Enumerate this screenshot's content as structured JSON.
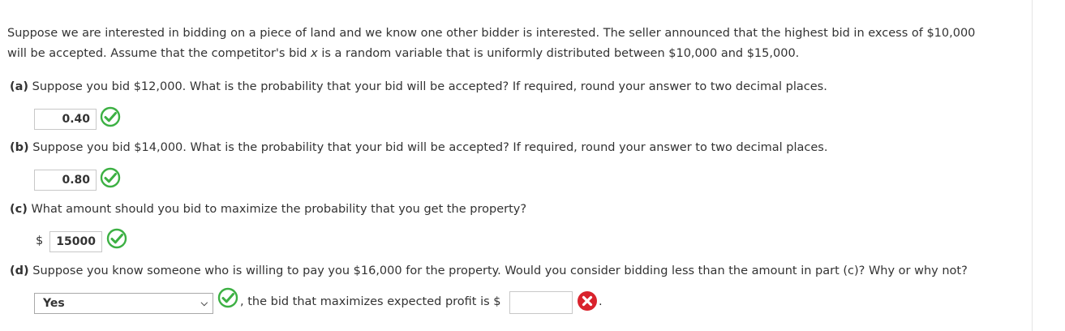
{
  "intro": {
    "line1": "Suppose we are interested in bidding on a piece of land and we know one other bidder is interested. The seller announced that the highest bid in excess of $10,000",
    "line2_a": "will be accepted. Assume that the competitor's bid ",
    "line2_var": "x",
    "line2_b": " is a random variable that is uniformly distributed between $10,000 and $15,000."
  },
  "parts": {
    "a": {
      "label": "(a)",
      "text": " Suppose you bid $12,000. What is the probability that your bid will be accepted? If required, round your answer to two decimal places.",
      "answer": "0.40"
    },
    "b": {
      "label": "(b)",
      "text": " Suppose you bid $14,000. What is the probability that your bid will be accepted? If required, round your answer to two decimal places.",
      "answer": "0.80"
    },
    "c": {
      "label": "(c)",
      "text": " What amount should you bid to maximize the probability that you get the property?",
      "currency": "$",
      "answer": "15000"
    },
    "d": {
      "label": "(d)",
      "text": " Suppose you know someone who is willing to pay you $16,000 for the property. Would you consider bidding less than the amount in part (c)? Why or why not?",
      "select_value": "Yes",
      "after_select": ", the bid that maximizes expected profit is $",
      "trailing": ".",
      "input_value": ""
    }
  },
  "icons": {
    "correct": "check-circle-icon",
    "incorrect": "x-circle-icon",
    "correct_color": "#3cb043",
    "incorrect_color": "#d9232d"
  }
}
